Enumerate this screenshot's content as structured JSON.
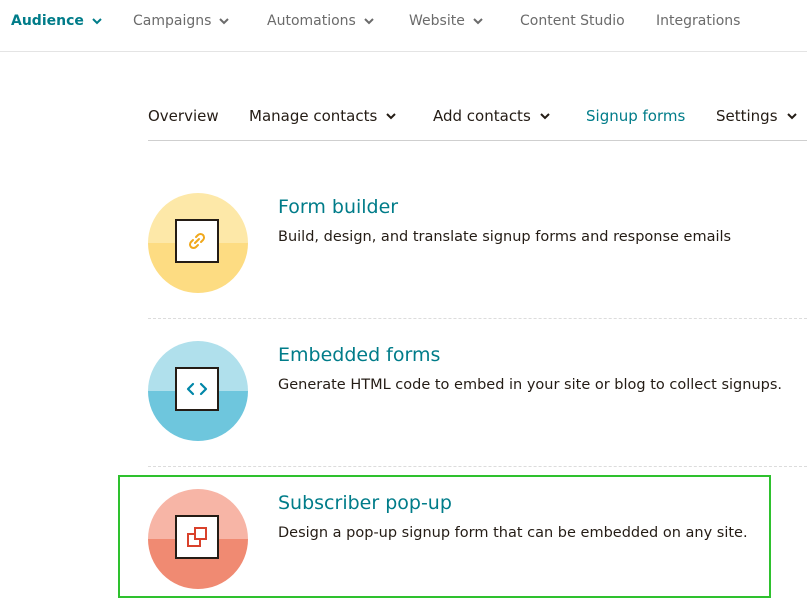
{
  "top_nav": {
    "items": [
      {
        "label": "Audience",
        "has_chevron": true
      },
      {
        "label": "Campaigns",
        "has_chevron": true
      },
      {
        "label": "Automations",
        "has_chevron": true
      },
      {
        "label": "Website",
        "has_chevron": true
      },
      {
        "label": "Content Studio",
        "has_chevron": false
      },
      {
        "label": "Integrations",
        "has_chevron": false
      }
    ]
  },
  "sub_nav": {
    "items": [
      {
        "label": "Overview",
        "has_chevron": false
      },
      {
        "label": "Manage contacts",
        "has_chevron": true
      },
      {
        "label": "Add contacts",
        "has_chevron": true
      },
      {
        "label": "Signup forms",
        "has_chevron": false
      },
      {
        "label": "Settings",
        "has_chevron": true
      }
    ]
  },
  "options": [
    {
      "title": "Form builder",
      "description": "Build, design, and translate signup forms and response emails",
      "icon": "link-icon",
      "colors": {
        "light": "#fde8a8",
        "dark": "#fddc82"
      }
    },
    {
      "title": "Embedded forms",
      "description": "Generate HTML code to embed in your site or blog to collect signups.",
      "icon": "code-icon",
      "colors": {
        "light": "#b0e0ec",
        "dark": "#6ec6dd"
      }
    },
    {
      "title": "Subscriber pop-up",
      "description": "Design a pop-up signup form that can be embedded on any site.",
      "icon": "popup-icon",
      "colors": {
        "light": "#f7b5a6",
        "dark": "#f08a72"
      }
    }
  ],
  "colors": {
    "accent": "#007c89",
    "text": "#241c15",
    "muted": "#6b6b6b",
    "highlight": "#2ec12e"
  }
}
